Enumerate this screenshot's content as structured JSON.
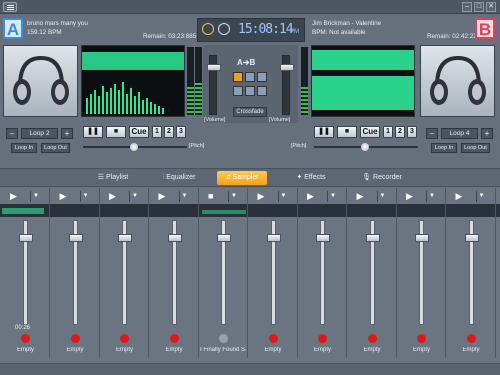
{
  "deck_a": {
    "letter": "A",
    "track": "bruno mars many you",
    "bpm": "159.12 BPM",
    "remain": "Remain: 03:23:885",
    "loop_label": "Loop 2",
    "loop_in": "Loop In",
    "loop_out": "Loop Out",
    "cue": "Cue",
    "hot1": "1",
    "hot2": "2",
    "hot3": "3",
    "pitch": "[Pitch]",
    "volume": "[Volume]",
    "minus": "–",
    "plus": "+"
  },
  "deck_b": {
    "letter": "B",
    "track": "Jim Brickman - Valentine",
    "bpm": "BPM: Not available",
    "remain": "Remain: 02:42:227",
    "loop_label": "Loop 4",
    "loop_in": "Loop In",
    "loop_out": "Loop Out",
    "cue": "Cue",
    "hot1": "1",
    "hot2": "2",
    "hot3": "3",
    "pitch": "[Pitch]",
    "volume": "[Volume]",
    "minus": "–",
    "plus": "+"
  },
  "clock": {
    "time": "15:08:14",
    "suffix": "PM"
  },
  "mixer": {
    "ab_label": "A➔B",
    "crossfade": "Crossfade"
  },
  "tabs": [
    {
      "label": "Playlist",
      "icon": "playlist-icon"
    },
    {
      "label": "Equalizer",
      "icon": "equalizer-icon"
    },
    {
      "label": "Sampler",
      "icon": "music-note-icon",
      "active": true
    },
    {
      "label": "Effects",
      "icon": "effects-icon"
    },
    {
      "label": "Recorder",
      "icon": "microphone-icon"
    }
  ],
  "sampler": {
    "slots": [
      {
        "label": "Empty",
        "time": "00:26",
        "level": 0.87
      },
      {
        "label": "Empty",
        "level": 0.87
      },
      {
        "label": "Empty",
        "level": 0.87
      },
      {
        "label": "Empty",
        "level": 0.87
      },
      {
        "label": "I Finally Found S...",
        "level": 0.87,
        "loaded": true
      },
      {
        "label": "Empty",
        "level": 0.87
      },
      {
        "label": "Empty",
        "level": 0.87
      },
      {
        "label": "Empty",
        "level": 0.87
      },
      {
        "label": "Empty",
        "level": 0.87
      },
      {
        "label": "Empty",
        "level": 0.87
      }
    ]
  },
  "colors": {
    "accent_a": "#3a8fd8",
    "accent_b": "#e0405a",
    "wave_green": "#2ee89a",
    "active_tab": "#f5a623"
  }
}
